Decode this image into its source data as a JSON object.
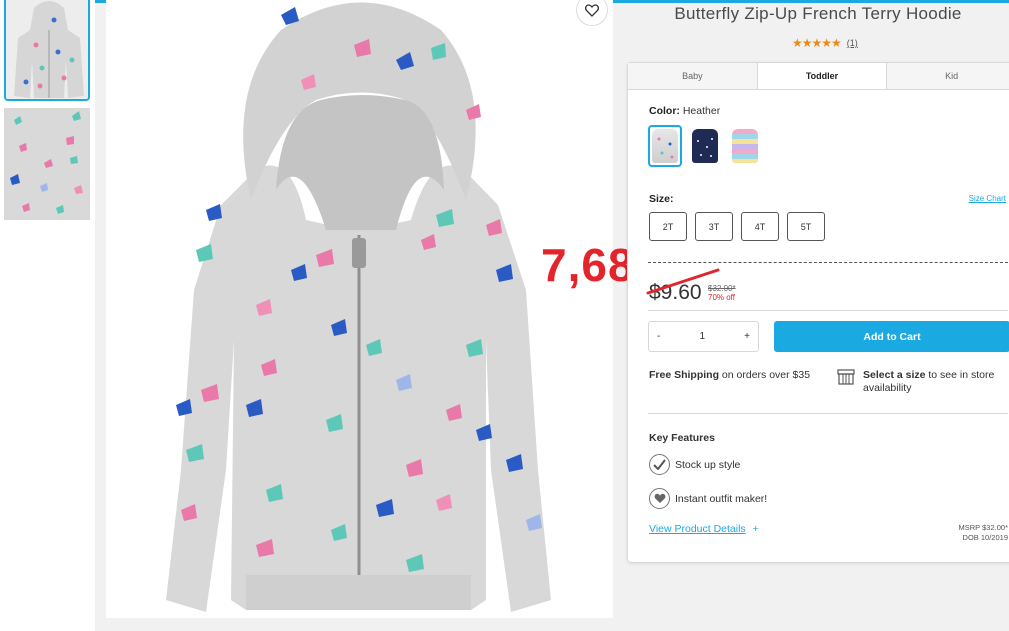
{
  "product": {
    "title": "Butterfly Zip-Up French Terry Hoodie",
    "stars": "★★★★★",
    "review_count": "(1)",
    "rating_value": 5,
    "star_color": "#ea8a1b"
  },
  "annotation": {
    "handwritten_price": "7,68",
    "color": "#e3242b"
  },
  "tabs": [
    {
      "label": "Baby",
      "active": false
    },
    {
      "label": "Toddler",
      "active": true
    },
    {
      "label": "Kid",
      "active": false
    }
  ],
  "color_selector": {
    "label": "Color:",
    "value": "Heather",
    "swatches": [
      "heather-grey",
      "navy",
      "pastel-stripe"
    ]
  },
  "size_selector": {
    "label": "Size:",
    "chart_link": "Size Chart",
    "options": [
      "2T",
      "3T",
      "4T",
      "5T"
    ]
  },
  "pricing": {
    "price": "$9.60",
    "old_price": "$32.00*",
    "discount": "70% off"
  },
  "cart": {
    "minus": "-",
    "quantity": "1",
    "plus": "+",
    "add_label": "Add to Cart",
    "accent": "#1ba9e1"
  },
  "shipping": {
    "bold": "Free Shipping",
    "rest": " on orders over $35"
  },
  "store": {
    "bold": "Select a size",
    "rest": " to see in store availability"
  },
  "features": {
    "heading": "Key Features",
    "items": [
      "Stock up style",
      "Instant outfit maker!"
    ]
  },
  "details": {
    "link": "View Product Details",
    "plus": "+",
    "msrp": "MSRP $32.00*",
    "dob": "DOB 10/2019"
  }
}
